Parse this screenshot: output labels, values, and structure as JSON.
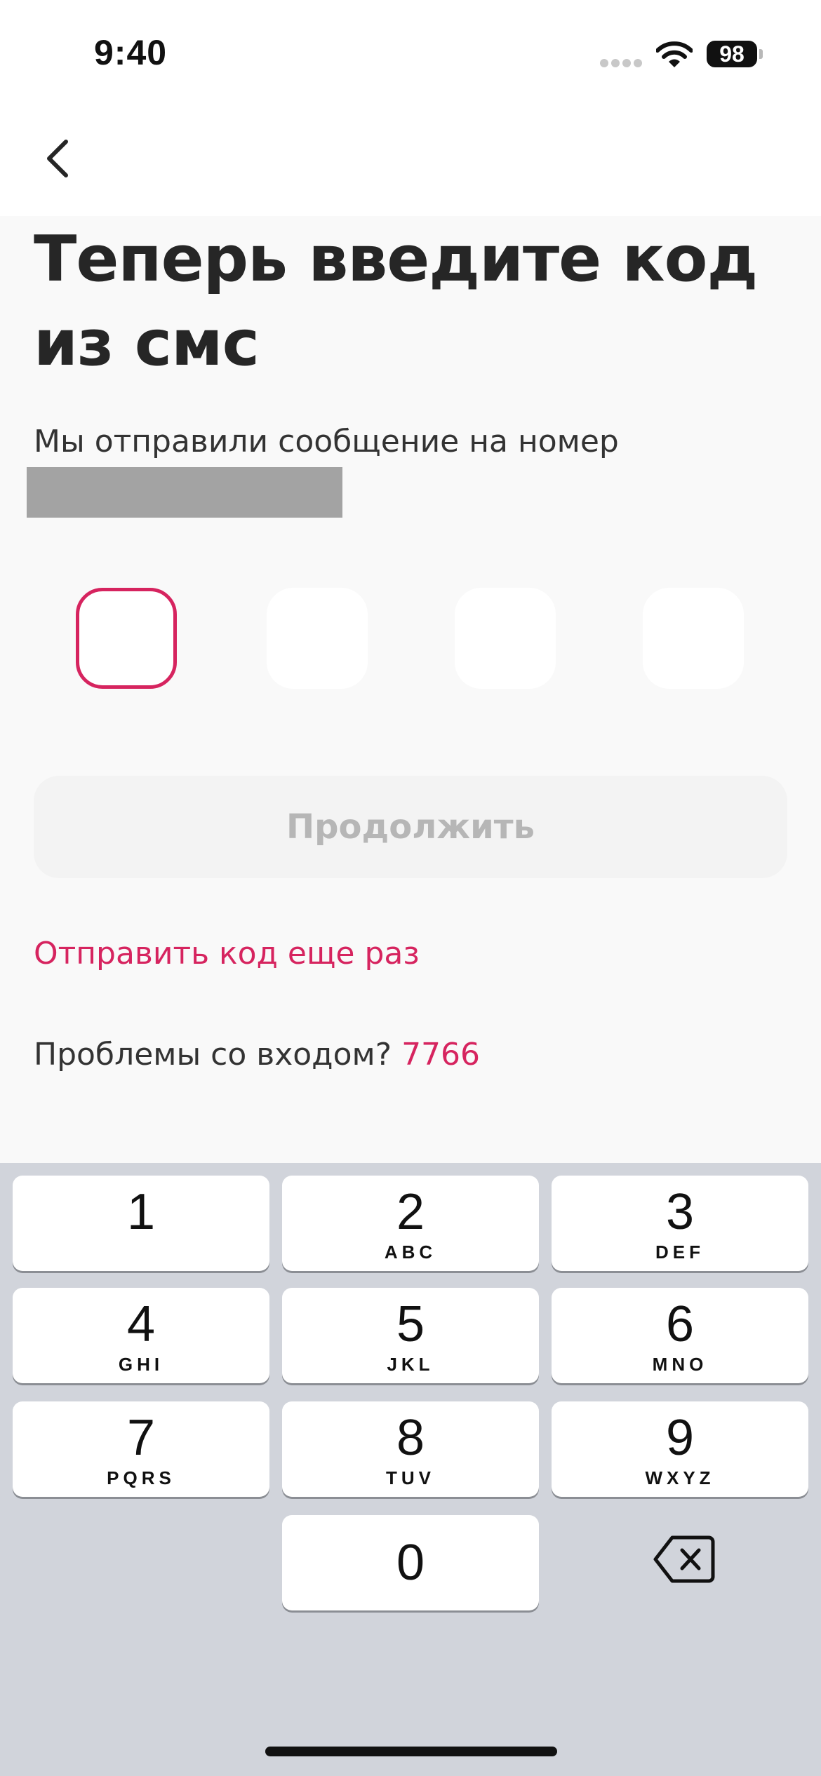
{
  "status_bar": {
    "time": "9:40",
    "battery": "98",
    "icons": [
      "signal-icon",
      "wifi-icon",
      "battery-icon"
    ]
  },
  "nav": {
    "back_icon": "chevron-left-icon"
  },
  "screen": {
    "title": "Теперь введите код из смс",
    "subtitle": "Мы отправили сообщение на номер",
    "code_boxes": [
      {
        "value": "",
        "active": true
      },
      {
        "value": "",
        "active": false
      },
      {
        "value": "",
        "active": false
      },
      {
        "value": "",
        "active": false
      }
    ],
    "continue_label": "Продолжить",
    "resend_label": "Отправить код еще раз",
    "help_text": "Проблемы со входом?",
    "help_number": "7766"
  },
  "colors": {
    "accent": "#d6245f",
    "background": "#f9f9f9",
    "button_disabled": "#f3f3f3",
    "keyboard": "#d1d4db"
  },
  "keyboard": {
    "keys": [
      {
        "digit": "1",
        "letters": ""
      },
      {
        "digit": "2",
        "letters": "ABC"
      },
      {
        "digit": "3",
        "letters": "DEF"
      },
      {
        "digit": "4",
        "letters": "GHI"
      },
      {
        "digit": "5",
        "letters": "JKL"
      },
      {
        "digit": "6",
        "letters": "MNO"
      },
      {
        "digit": "7",
        "letters": "PQRS"
      },
      {
        "digit": "8",
        "letters": "TUV"
      },
      {
        "digit": "9",
        "letters": "WXYZ"
      },
      {
        "digit": "0",
        "letters": ""
      }
    ],
    "delete_icon": "backspace-icon"
  }
}
